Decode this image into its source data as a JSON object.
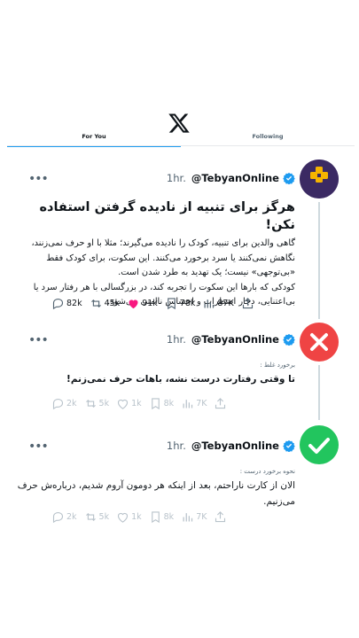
{
  "tabs": [
    {
      "label": "For You"
    },
    {
      "label": "Following"
    }
  ],
  "tweets": [
    {
      "time": "1hr.",
      "handle": "@TebyanOnline",
      "title": "هرگز برای تنبیه از نادیده گرفتن استفاده نکن!",
      "lines": [
        "گاهی والدین برای تنبیه، کودک را نادیده می‌گیرند؛ مثلا با او حرف نمی‌زنند،",
        "نگاهش نمی‌کنند یا سرد برخورد می‌کنند. این سکوت، برای کودک فقط",
        "«بی‌توجهی» نیست؛ یک تهدید به طرد شدن است.",
        "کودکی که بارها این سکوت را تجربه کند، در بزرگسالی با هر رفتار سرد یا",
        "بی‌اعتنایی، دچار اضطراب و احساس ناامنی می‌شود."
      ],
      "replies": "82k",
      "reposts": "45k",
      "likes": "91k",
      "bookmarks": "78k",
      "views": "87K",
      "avatar_label": "تبیان"
    },
    {
      "time": "1hr.",
      "handle": "@TebyanOnline",
      "label": "برخورد غلط :",
      "text": "تا وقتی رفتارت درست نشه، باهات حرف نمی‌زنم!",
      "replies": "2k",
      "reposts": "5k",
      "likes": "1k",
      "bookmarks": "8k",
      "views": "7K",
      "avatar_color": "#ef4444"
    },
    {
      "time": "1hr.",
      "handle": "@TebyanOnline",
      "label": "نحوه برخورد درست :",
      "text": "الان از کارت ناراحتم، بعد از اینکه هر دومون آروم شدیم، درباره‌ش حرف می‌زنیم.",
      "replies": "2k",
      "reposts": "5k",
      "likes": "1k",
      "bookmarks": "8k",
      "views": "7K",
      "avatar_color": "#22c55e"
    }
  ]
}
